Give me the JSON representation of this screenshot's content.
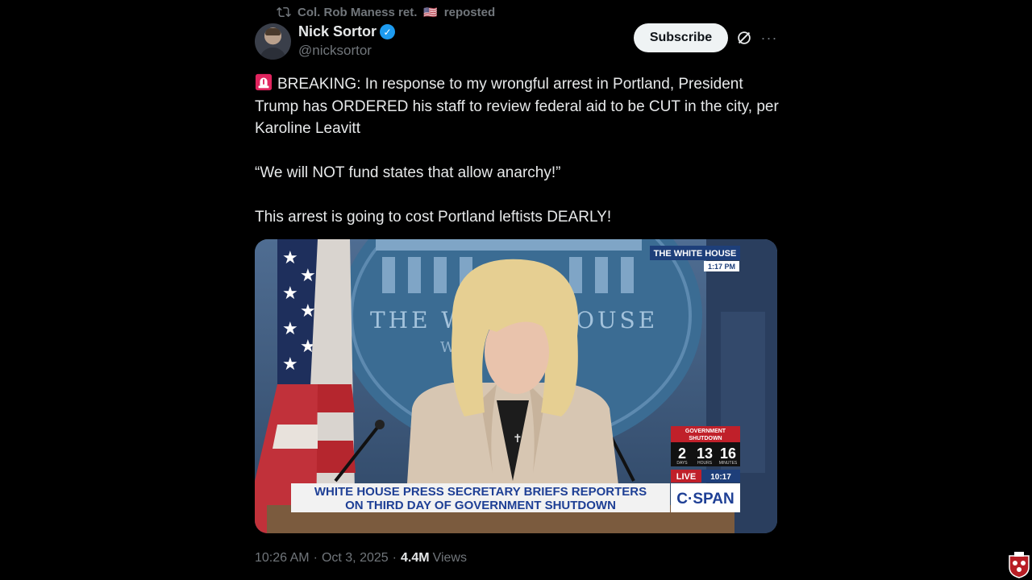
{
  "repost": {
    "icon": "repost-icon",
    "text_before_flag": "Col. Rob Maness ret.",
    "flag": "🇺🇸",
    "text_after_flag": "reposted"
  },
  "author": {
    "name": "Nick Sortor",
    "handle": "@nicksortor",
    "verified": true
  },
  "actions": {
    "subscribe_label": "Subscribe",
    "more_label": "···"
  },
  "tweet": {
    "line1": "BREAKING: In response to my wrongful arrest in Portland, President Trump has ORDERED his staff to review federal aid to be CUT in the city, per Karoline Leavitt",
    "line2": "“We will NOT fund states that allow anarchy!”",
    "line3": "This arrest is going to cost Portland leftists DEARLY!"
  },
  "media": {
    "seal_text_left": "THE WH",
    "seal_text_right": "OUSE",
    "seal_sub": "W",
    "bug_title": "THE WHITE HOUSE",
    "bug_time": "1:17 PM",
    "shutdown_label_1": "GOVERNMENT",
    "shutdown_label_2": "SHUTDOWN",
    "countdown": {
      "days": "2",
      "hours": "13",
      "minutes": "16"
    },
    "countdown_units": {
      "days": "DAYS",
      "hours": "HOURS",
      "minutes": "MINUTES"
    },
    "live_label": "LIVE",
    "live_time": "10:17",
    "network": "C·SPAN",
    "headline_1": "WHITE HOUSE PRESS SECRETARY BRIEFS REPORTERS",
    "headline_2": "ON THIRD DAY OF GOVERNMENT SHUTDOWN"
  },
  "meta": {
    "time": "10:26 AM",
    "date": "Oct 3, 2025",
    "views_count": "4.4M",
    "views_label": "Views"
  },
  "colors": {
    "background": "#000000",
    "text": "#e7e9ea",
    "muted": "#71767b",
    "verified": "#1d9bf0",
    "subscribe_bg": "#eff3f4"
  }
}
